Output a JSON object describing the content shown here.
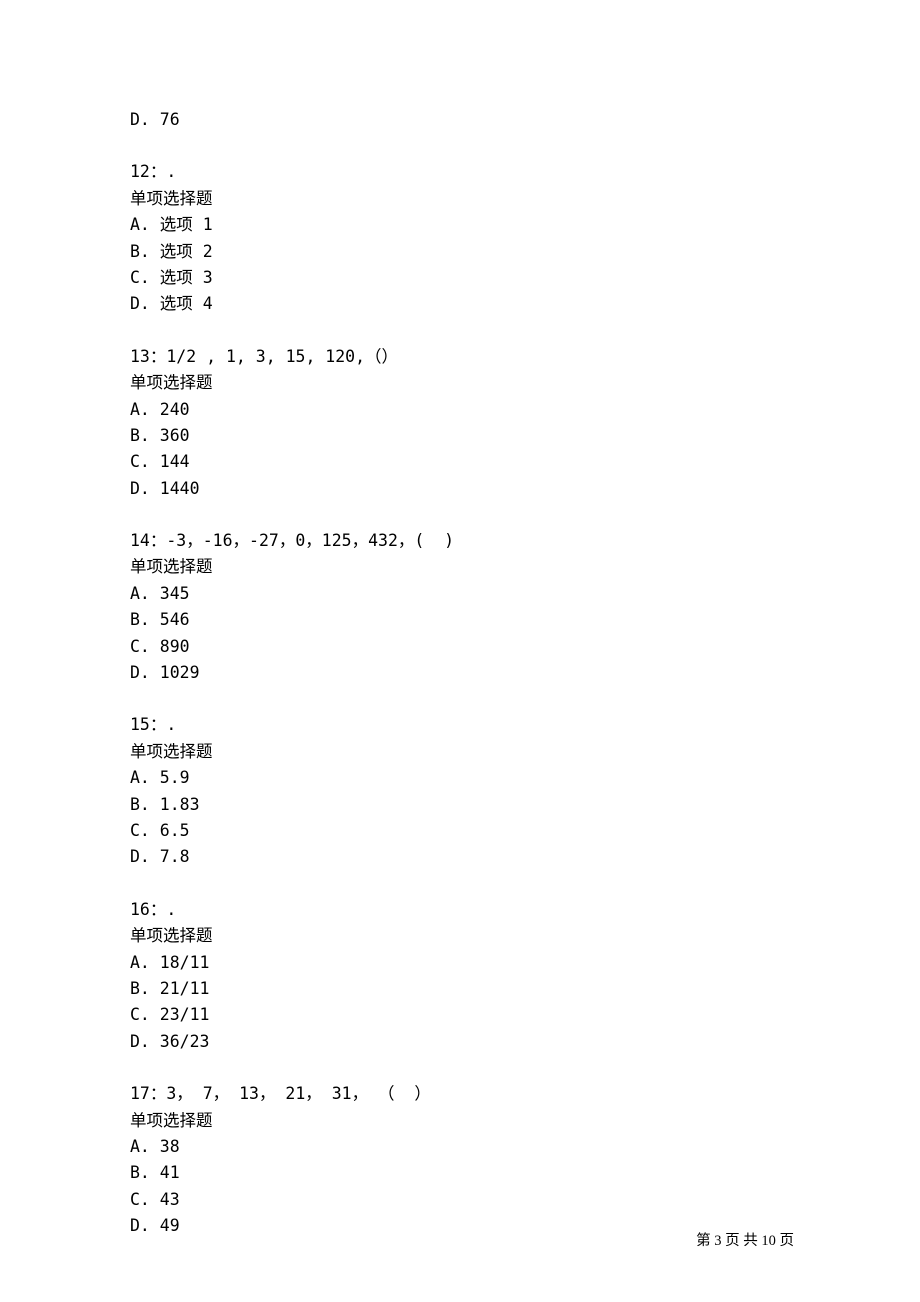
{
  "orphan_option": "D. 76",
  "questions": [
    {
      "number": "12：.",
      "type": "单项选择题",
      "options": [
        "A. 选项 1",
        "B. 选项 2",
        "C. 选项 3",
        "D. 选项 4"
      ]
    },
    {
      "number": "13：1/2 , 1, 3, 15, 120,（）",
      "type": "单项选择题",
      "options": [
        "A. 240",
        "B. 360",
        "C. 144",
        "D. 1440"
      ]
    },
    {
      "number": "14：-3，-16，-27，0，125，432，(  )",
      "type": "单项选择题",
      "options": [
        "A. 345",
        "B. 546",
        "C. 890",
        "D. 1029"
      ]
    },
    {
      "number": "15：.",
      "type": "单项选择题",
      "options": [
        "A. 5.9",
        "B. 1.83",
        "C. 6.5",
        "D. 7.8"
      ]
    },
    {
      "number": "16：.",
      "type": "单项选择题",
      "options": [
        "A. 18/11",
        "B. 21/11",
        "C. 23/11",
        "D. 36/23"
      ]
    },
    {
      "number": "17：3， 7， 13， 21， 31， （  ）",
      "type": "单项选择题",
      "options": [
        "A. 38",
        "B. 41",
        "C. 43",
        "D. 49"
      ]
    }
  ],
  "footer": {
    "prefix": "第 ",
    "current": "3",
    "middle": " 页 共 ",
    "total": "10",
    "suffix": " 页"
  }
}
